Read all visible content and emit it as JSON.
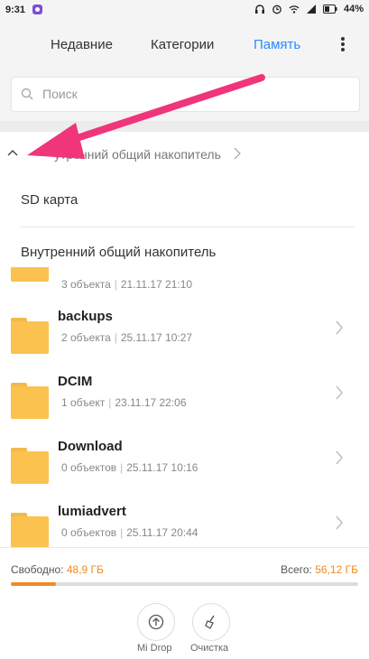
{
  "status": {
    "time": "9:31",
    "battery": "44%"
  },
  "tabs": [
    {
      "label": "Недавние"
    },
    {
      "label": "Категории"
    },
    {
      "label": "Память"
    }
  ],
  "search": {
    "placeholder": "Поиск"
  },
  "path": {
    "label": "утренний общий накопитель"
  },
  "dropdown": [
    {
      "label": "SD карта"
    },
    {
      "label": "Внутренний общий накопитель"
    }
  ],
  "partial_row": {
    "count": "3 объекта",
    "date": "21.11.17 21:10"
  },
  "files": [
    {
      "name": "backups",
      "count": "2 объекта",
      "date": "25.11.17 10:27"
    },
    {
      "name": "DCIM",
      "count": "1 объект",
      "date": "23.11.17 22:06"
    },
    {
      "name": "Download",
      "count": "0 объектов",
      "date": "25.11.17 10:16"
    },
    {
      "name": "lumiadvert",
      "count": "0 объектов",
      "date": "25.11.17 20:44"
    }
  ],
  "storage": {
    "free_label": "Свободно:",
    "free_value": "48,9 ГБ",
    "total_label": "Всего:",
    "total_value": "56,12 ГБ",
    "used_fraction": 0.13
  },
  "bottom": [
    {
      "label": "Mi Drop"
    },
    {
      "label": "Очистка"
    }
  ],
  "colors": {
    "accent": "#2b8bff",
    "orange": "#f08a24",
    "folder": "#fbc24f",
    "arrow": "#f0357a"
  }
}
